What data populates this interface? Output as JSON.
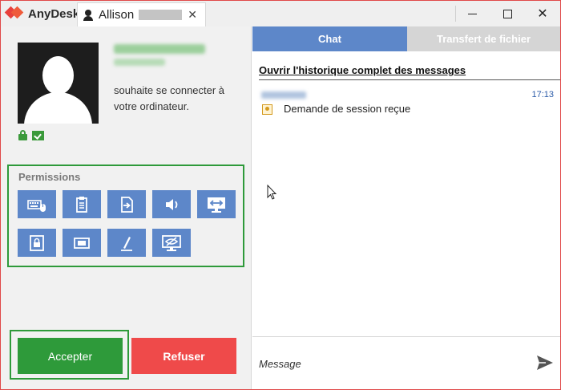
{
  "titlebar": {
    "app_name": "AnyDesk",
    "tab_label": "Allison",
    "tab_close": "✕",
    "minimize": "minimize",
    "maximize": "maximize",
    "close": "✕"
  },
  "request": {
    "message": "souhaite se connecter à votre ordinateur."
  },
  "permissions": {
    "title": "Permissions",
    "items": [
      {
        "icon": "keyboard-mouse-icon"
      },
      {
        "icon": "clipboard-icon"
      },
      {
        "icon": "file-transfer-icon"
      },
      {
        "icon": "sound-icon"
      },
      {
        "icon": "screen-control-icon"
      },
      {
        "icon": "lock-desktop-icon"
      },
      {
        "icon": "record-session-icon"
      },
      {
        "icon": "draw-icon"
      },
      {
        "icon": "privacy-mode-icon"
      }
    ]
  },
  "actions": {
    "accept": "Accepter",
    "refuse": "Refuser"
  },
  "chat": {
    "tab_chat": "Chat",
    "tab_file_transfer": "Transfert de fichier",
    "history_link": "Ouvrir l'historique complet des messages",
    "messages": [
      {
        "time": "17:13",
        "text": "Demande de session reçue"
      }
    ],
    "input_placeholder": "Message"
  },
  "colors": {
    "accent_blue": "#5d87c9",
    "accept_green": "#2e9a3a",
    "refuse_red": "#ef4a4a",
    "window_border": "#e04848"
  }
}
